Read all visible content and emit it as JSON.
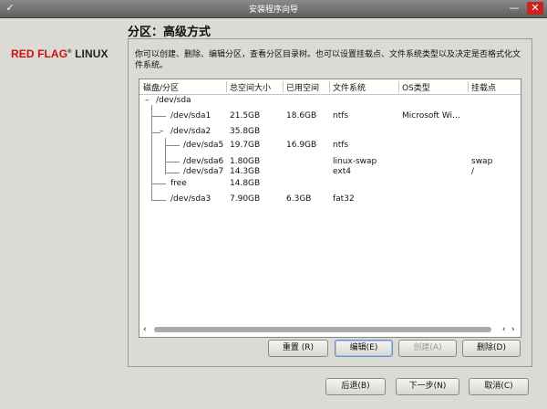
{
  "window": {
    "title": "安装程序向导",
    "icon_left": "menu-icon",
    "minimize": "_",
    "close": "X"
  },
  "header": {
    "title": "分区：高级方式"
  },
  "brand": {
    "red": "RED FLAG",
    "reg": "®",
    "rest": " LINUX"
  },
  "description": "你可以创建、删除、编辑分区，查看分区目录树。也可以设置挂载点、文件系统类型以及决定是否格式化文件系统。",
  "table": {
    "columns": [
      "磁盘/分区",
      "总空间大小",
      "已用空间",
      "文件系统",
      "OS类型",
      "挂载点"
    ],
    "rows": [
      {
        "name": "/dev/sda",
        "size": "",
        "used": "",
        "fs": "",
        "os": "",
        "mount": ""
      },
      {
        "name": "/dev/sda1",
        "size": "21.5GB",
        "used": "18.6GB",
        "fs": "ntfs",
        "os": "Microsoft Wi…",
        "mount": ""
      },
      {
        "name": "/dev/sda2",
        "size": "35.8GB",
        "used": "",
        "fs": "",
        "os": "",
        "mount": ""
      },
      {
        "name": "/dev/sda5",
        "size": "19.7GB",
        "used": "16.9GB",
        "fs": "ntfs",
        "os": "",
        "mount": ""
      },
      {
        "name": "/dev/sda6",
        "size": "1.80GB",
        "used": "",
        "fs": "linux-swap",
        "os": "",
        "mount": "swap"
      },
      {
        "name": "/dev/sda7",
        "size": "14.3GB",
        "used": "",
        "fs": "ext4",
        "os": "",
        "mount": "/"
      },
      {
        "name": "free",
        "size": "14.8GB",
        "used": "",
        "fs": "",
        "os": "",
        "mount": ""
      },
      {
        "name": "/dev/sda3",
        "size": "7.90GB",
        "used": "6.3GB",
        "fs": "fat32",
        "os": "",
        "mount": ""
      }
    ]
  },
  "partition_buttons": {
    "reset": "重置 (R)",
    "edit": "编辑(E)",
    "create": "创建(A)",
    "delete": "删除(D)"
  },
  "nav_buttons": {
    "back": "后退(B)",
    "next": "下一步(N)",
    "cancel": "取消(C)"
  },
  "scrollbar": {
    "left": "‹",
    "right": "›"
  }
}
